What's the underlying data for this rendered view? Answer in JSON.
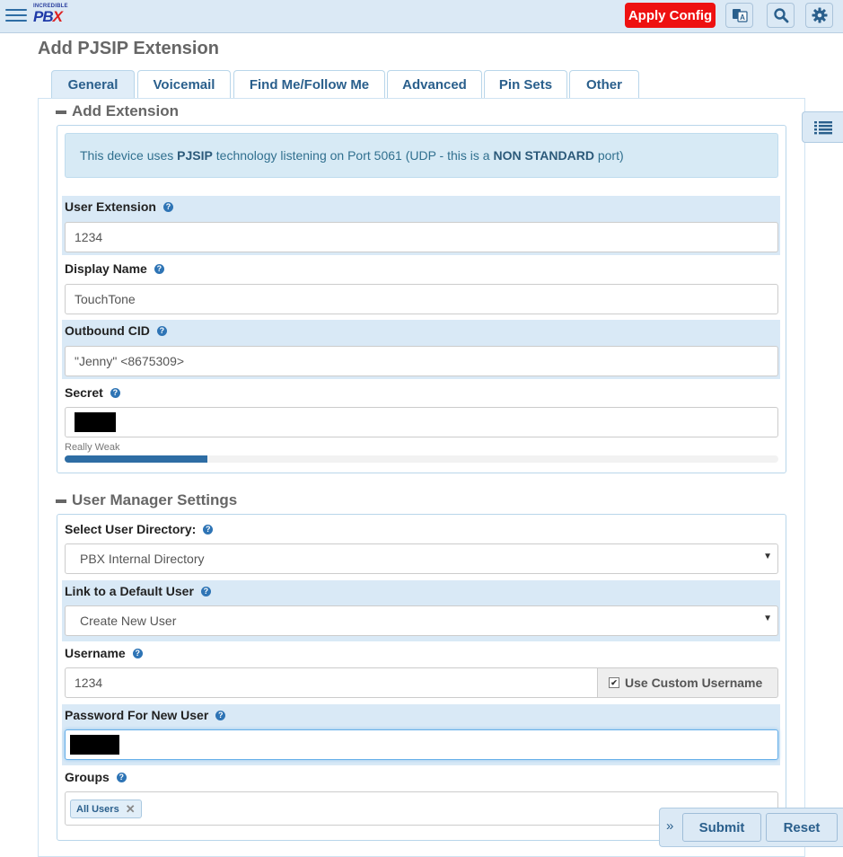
{
  "topbar": {
    "logo_small": "INCREDIBLE",
    "logo_big": "PB",
    "logo_x": "X",
    "apply_label": "Apply Config",
    "accent_color": "#ee1111",
    "icons": [
      "translate-icon",
      "search-icon",
      "gear-icon"
    ]
  },
  "page": {
    "title": "Add PJSIP Extension"
  },
  "tabs": [
    {
      "label": "General",
      "active": true
    },
    {
      "label": "Voicemail"
    },
    {
      "label": "Find Me/Follow Me"
    },
    {
      "label": "Advanced"
    },
    {
      "label": "Pin Sets"
    },
    {
      "label": "Other"
    }
  ],
  "add_extension": {
    "title": "Add Extension",
    "info_prefix": "This device uses ",
    "info_tech": "PJSIP",
    "info_middle": " technology listening on Port 5061 (UDP - this is a ",
    "info_nonstd": "NON STANDARD",
    "info_suffix": " port)",
    "user_extension": {
      "label": "User Extension",
      "value": "1234"
    },
    "display_name": {
      "label": "Display Name",
      "value": "TouchTone"
    },
    "outbound_cid": {
      "label": "Outbound CID",
      "value": "\"Jenny\" <8675309>"
    },
    "secret": {
      "label": "Secret",
      "strength_label": "Really Weak",
      "strength": 0.2
    }
  },
  "user_manager": {
    "title": "User Manager Settings",
    "directory": {
      "label": "Select User Directory:",
      "value": "PBX Internal Directory"
    },
    "default_user": {
      "label": "Link to a Default User",
      "value": "Create New User"
    },
    "username": {
      "label": "Username",
      "value": "1234",
      "custom_label": "Use Custom Username",
      "custom_checked": true
    },
    "password": {
      "label": "Password For New User"
    },
    "groups": {
      "label": "Groups",
      "tags": [
        "All Users"
      ]
    }
  },
  "actions": {
    "submit": "Submit",
    "reset": "Reset"
  },
  "help_glyph": "?"
}
